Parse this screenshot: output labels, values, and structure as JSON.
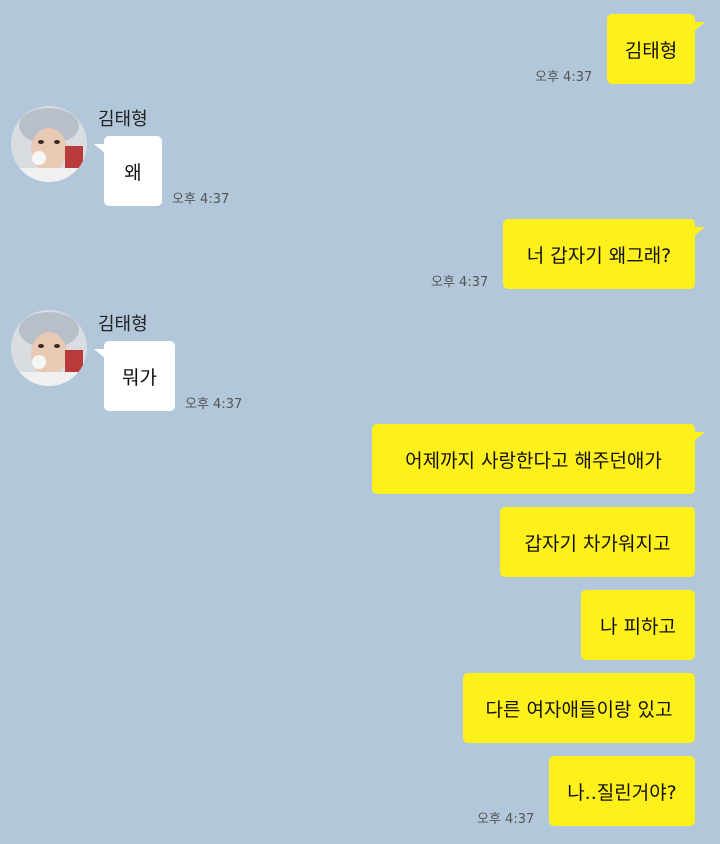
{
  "contact": {
    "name": "김태형"
  },
  "messages": [
    {
      "sender": "me",
      "text": "김태형",
      "time": "오후 4:37"
    },
    {
      "sender": "them",
      "text": "왜",
      "time": "오후 4:37"
    },
    {
      "sender": "me",
      "text": "너 갑자기 왜그래?",
      "time": "오후 4:37"
    },
    {
      "sender": "them",
      "text": "뭐가",
      "time": "오후 4:37"
    },
    {
      "sender": "me",
      "text": "어제까지 사랑한다고 해주던애가"
    },
    {
      "sender": "me",
      "text": "갑자기 차가워지고"
    },
    {
      "sender": "me",
      "text": "나 피하고"
    },
    {
      "sender": "me",
      "text": "다른 여자애들이랑 있고"
    },
    {
      "sender": "me",
      "text": "나..질린거야?",
      "time": "오후 4:37"
    }
  ],
  "colors": {
    "background": "#b2c7da",
    "my_bubble": "#fef01b",
    "their_bubble": "#ffffff"
  },
  "icons": {
    "avatar": "profile-photo"
  }
}
